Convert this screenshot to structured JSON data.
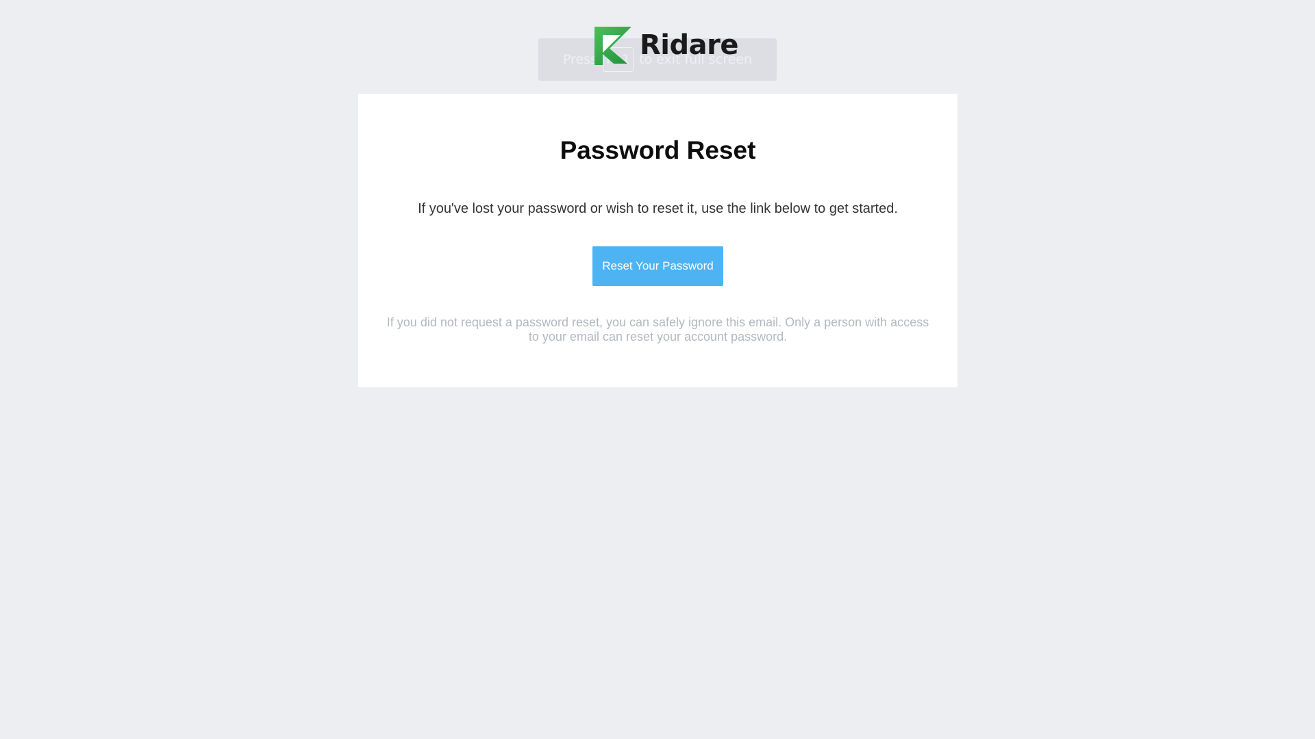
{
  "fullscreen_hint": {
    "prefix": "Press",
    "key": "F11",
    "suffix": "to exit full screen"
  },
  "brand": {
    "name": "Ridare",
    "logo_icon": "ridare-chevron-logo",
    "logo_color": "#3aaa4a"
  },
  "card": {
    "title": "Password Reset",
    "intro": "If you've lost your password or wish to reset it, use the link below to get started.",
    "button_label": "Reset Your Password",
    "button_color": "#4db3f2",
    "note": "If you did not request a password reset, you can safely ignore this email. Only a person with access to your email can reset your account password."
  }
}
